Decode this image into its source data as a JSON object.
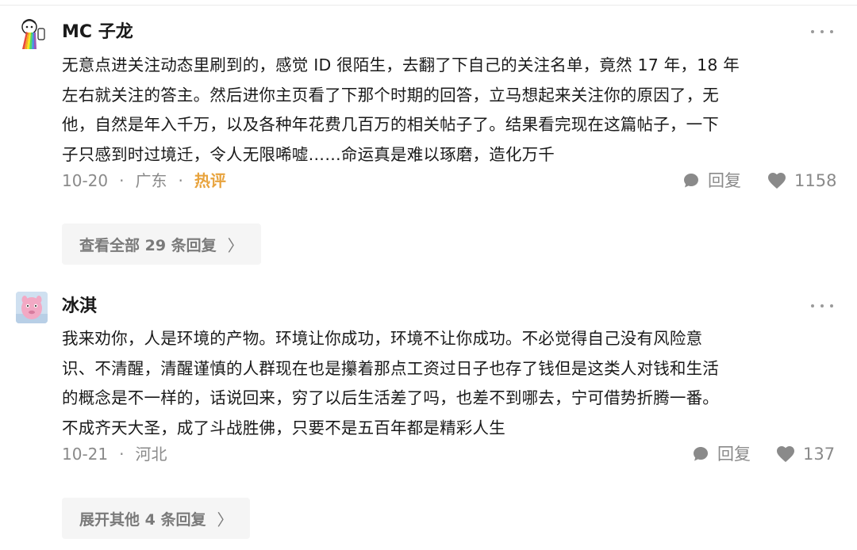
{
  "comments": [
    {
      "author": "MC 子龙",
      "avatar_icon": "rainbow-cartoon-avatar",
      "lines": [
        "无意点进关注动态里刷到的，感觉 ID 很陌生，去翻了下自己的关注名单，竟然 17 年，18 年",
        "左右就关注的答主。然后进你主页看了下那个时期的回答，立马想起来关注你的原因了，无",
        "他，自然是年入千万，以及各种年花费几百万的相关帖子了。结果看完现在这篇帖子，一下",
        "子只感到时过境迁，令人无限唏嘘……命运真是难以琢磨，造化万千"
      ],
      "date": "10-20",
      "location": "广东",
      "badge": "热评",
      "reply_label": "回复",
      "likes": "1158",
      "expand_label": "查看全部 29 条回复",
      "chevron": "〉"
    },
    {
      "author": "冰淇",
      "avatar_icon": "pink-creature-avatar",
      "lines": [
        "我来劝你，人是环境的产物。环境让你成功，环境不让你成功。不必觉得自己没有风险意",
        "识、不清醒，清醒谨慎的人群现在也是攥着那点工资过日子也存了钱但是这类人对钱和生活",
        "的概念是不一样的，话说回来，穷了以后生活差了吗，也差不到哪去，宁可借势折腾一番。",
        "不成齐天大圣，成了斗战胜佛，只要不是五百年都是精彩人生"
      ],
      "date": "10-21",
      "location": "河北",
      "reply_label": "回复",
      "likes": "137",
      "expand_label": "展开其他 4 条回复",
      "chevron": "〉"
    }
  ],
  "colors": {
    "meta_gray": "#8a8a8a",
    "hot_badge": "#e8a33d",
    "button_bg": "#f5f5f5"
  }
}
